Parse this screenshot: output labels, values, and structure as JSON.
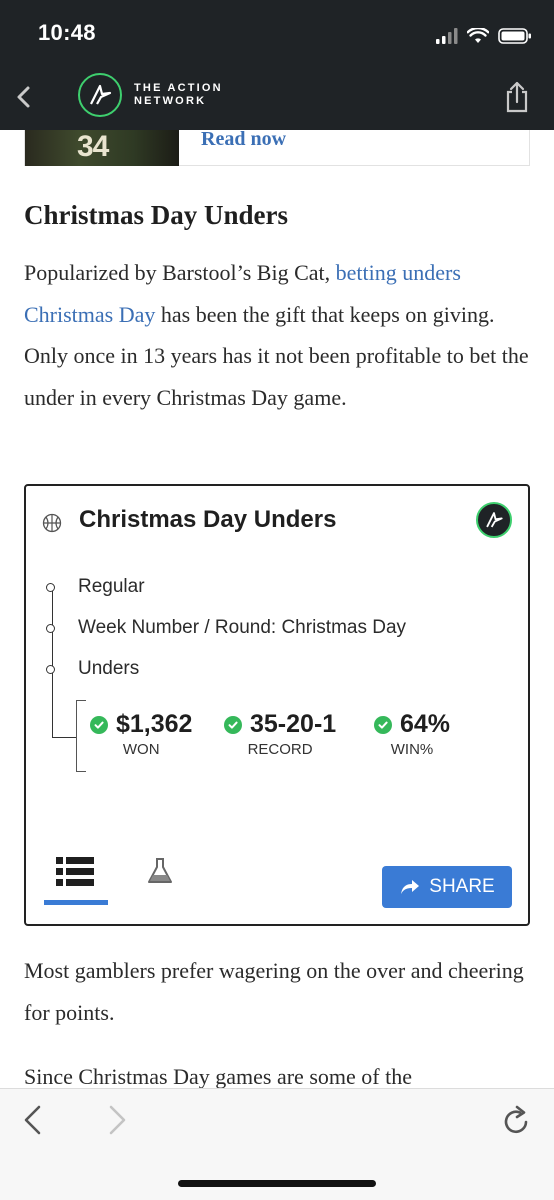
{
  "status_bar": {
    "time": "10:48"
  },
  "header": {
    "brand_line1": "THE ACTION",
    "brand_line2": "NETWORK"
  },
  "promo": {
    "jersey_number": "34",
    "link_text": "Read now"
  },
  "article": {
    "heading": "Christmas Day Unders",
    "para1_before": "Popularized by Barstool’s Big Cat, ",
    "para1_link": "betting unders Christmas Day",
    "para1_after": " has been the gift that keeps on giving. Only once in 13 years has it not been profitable to bet the under in every Christmas Day game.",
    "para2": "Most gamblers prefer wagering on the over and cheering for points.",
    "para3": "Since Christmas Day games are some of the"
  },
  "system_card": {
    "title": "Christmas Day Unders",
    "filters": [
      "Regular",
      "Week Number / Round: Christmas Day",
      "Unders"
    ],
    "stats": [
      {
        "value": "$1,362",
        "label": "WON"
      },
      {
        "value": "35-20-1",
        "label": "RECORD"
      },
      {
        "value": "64%",
        "label": "WIN%"
      }
    ],
    "share_label": "SHARE"
  },
  "colors": {
    "header_bg": "#1f2326",
    "accent_blue": "#3a7bd5",
    "link_blue": "#3b6fb5",
    "check_green": "#35b85a",
    "brand_green": "#3ecf6e"
  },
  "icons": {
    "status": [
      "signal-bars-icon",
      "wifi-icon",
      "battery-icon"
    ],
    "header": [
      "back-chevron-icon",
      "action-network-logo",
      "share-icon"
    ],
    "card": [
      "basketball-icon",
      "action-network-badge-icon",
      "check-circle-icon",
      "list-icon",
      "flask-icon",
      "share-arrow-icon"
    ],
    "browser": [
      "browser-back-icon",
      "browser-forward-icon",
      "reload-icon"
    ]
  }
}
